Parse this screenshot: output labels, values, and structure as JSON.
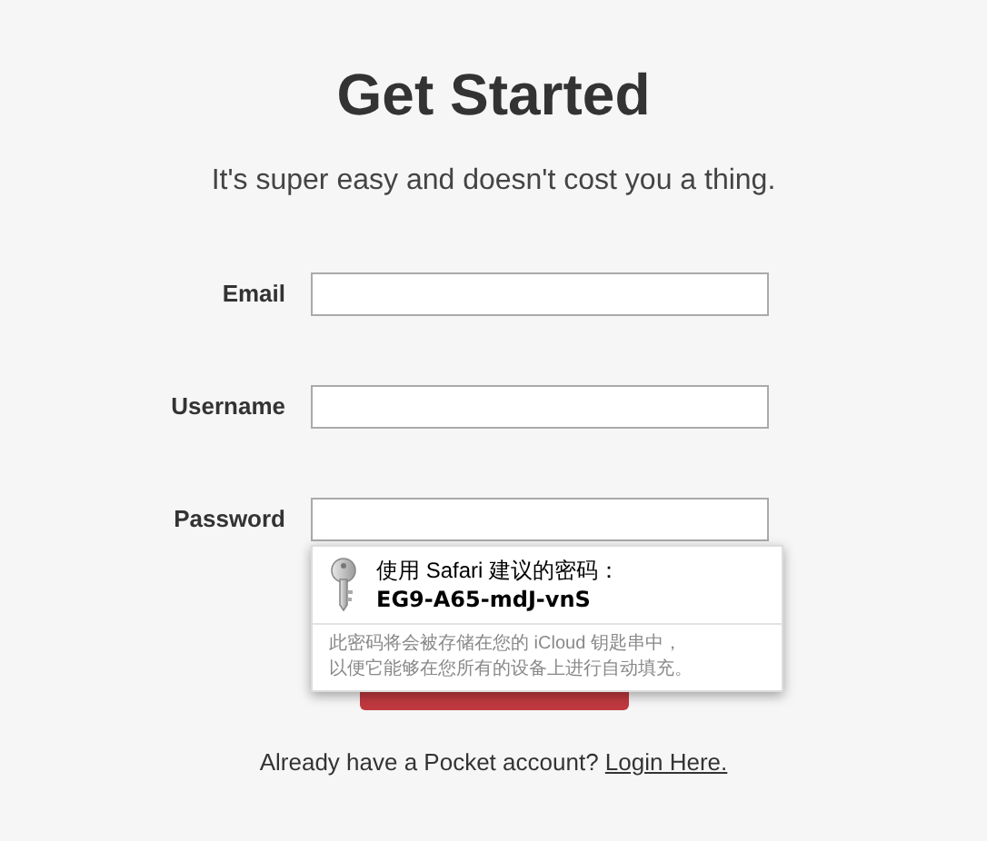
{
  "heading": "Get Started",
  "subheading": "It's super easy and doesn't cost you a thing.",
  "fields": [
    {
      "label": "Email"
    },
    {
      "label": "Username"
    },
    {
      "label": "Password"
    }
  ],
  "password_suggestion": {
    "title": "使用 Safari 建议的密码：",
    "password": "EG9-A65-mdJ-vnS",
    "note_lines": [
      "此密码将会被存储在您的 iCloud 钥匙串中，",
      "以便它能够在您所有的设备上进行自动填充。"
    ]
  },
  "footer": {
    "text": "Already have a Pocket account?",
    "link": "Login Here."
  }
}
